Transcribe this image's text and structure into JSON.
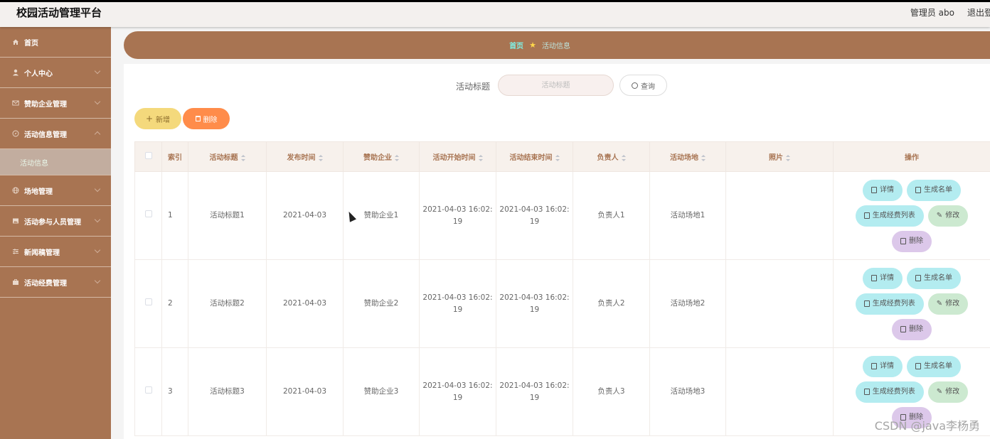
{
  "header": {
    "app_title": "校园活动管理平台",
    "admin_text": "管理员 abo",
    "logout_label": "退出登录"
  },
  "sidebar": {
    "items": [
      {
        "label": "首页",
        "icon": "home-icon"
      },
      {
        "label": "个人中心",
        "icon": "user-icon"
      },
      {
        "label": "赞助企业管理",
        "icon": "mail-icon"
      },
      {
        "label": "活动信息管理",
        "icon": "compass-icon",
        "expanded": true,
        "sub": [
          {
            "label": "活动信息",
            "active": true
          }
        ]
      },
      {
        "label": "场地管理",
        "icon": "globe-icon"
      },
      {
        "label": "活动参与人员管理",
        "icon": "picture-icon"
      },
      {
        "label": "新闻稿管理",
        "icon": "sliders-icon"
      },
      {
        "label": "活动经费管理",
        "icon": "briefcase-icon"
      }
    ]
  },
  "breadcrumb": {
    "home": "首页",
    "current": "活动信息"
  },
  "search": {
    "label": "活动标题",
    "placeholder": "活动标题",
    "button_label": "查询"
  },
  "actions": {
    "add_label": "新增",
    "delete_label": "删除"
  },
  "table": {
    "columns": [
      "索引",
      "活动标题",
      "发布时间",
      "赞助企业",
      "活动开始时间",
      "活动结束时间",
      "负责人",
      "活动场地",
      "照片",
      "操作"
    ],
    "rows": [
      {
        "index": "1",
        "title": "活动标题1",
        "publish": "2021-04-03",
        "sponsor": "赞助企业1",
        "start_a": "2021-04-03 16:02:",
        "start_b": "19",
        "end_a": "2021-04-03 16:02:",
        "end_b": "19",
        "leader": "负责人1",
        "venue": "活动场地1"
      },
      {
        "index": "2",
        "title": "活动标题2",
        "publish": "2021-04-03",
        "sponsor": "赞助企业2",
        "start_a": "2021-04-03 16:02:",
        "start_b": "19",
        "end_a": "2021-04-03 16:02:",
        "end_b": "19",
        "leader": "负责人2",
        "venue": "活动场地2"
      },
      {
        "index": "3",
        "title": "活动标题3",
        "publish": "2021-04-03",
        "sponsor": "赞助企业3",
        "start_a": "2021-04-03 16:02:",
        "start_b": "19",
        "end_a": "2021-04-03 16:02:",
        "end_b": "19",
        "leader": "负责人3",
        "venue": "活动场地3"
      }
    ],
    "ops": {
      "detail": "详情",
      "namelist": "生成名单",
      "fee": "生成经费列表",
      "edit": "修改",
      "remove": "删除"
    }
  },
  "watermark": "CSDN @java李杨勇",
  "colors": {
    "brand": "#a87452",
    "add_button": "#f4d97c",
    "delete_button": "#ff8c4a",
    "op_cyan": "#b3ecf0",
    "op_green": "#cce9d0",
    "op_purple": "#dcc8ea"
  }
}
